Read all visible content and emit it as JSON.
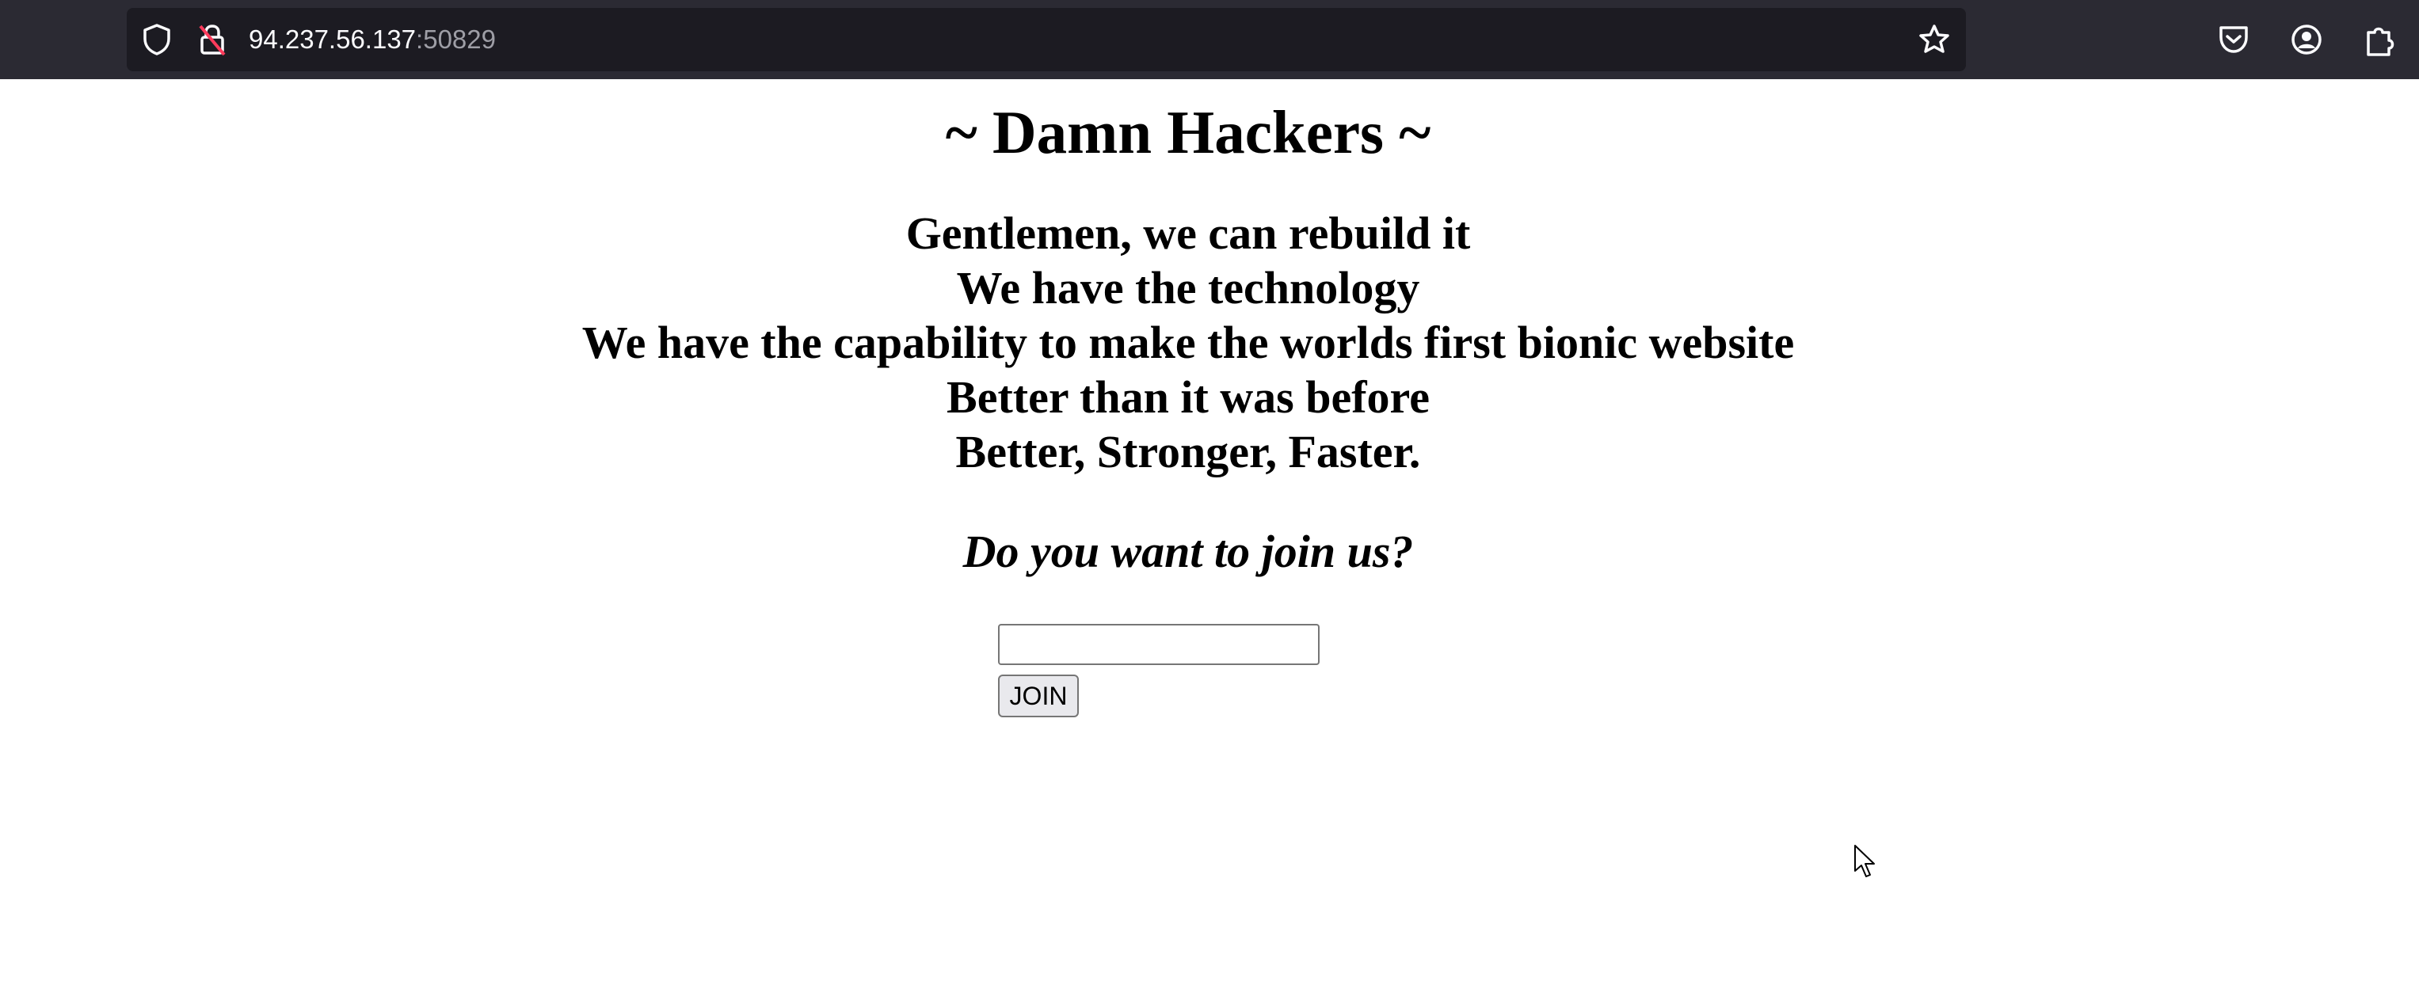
{
  "browser": {
    "url_host": "94.237.56.137",
    "url_port": ":50829",
    "icons": [
      "shield-icon",
      "insecure-lock-icon",
      "bookmark-star-icon",
      "pocket-icon",
      "account-icon",
      "extensions-icon"
    ]
  },
  "page": {
    "title": "~ Damn Hackers ~",
    "lines": [
      "Gentlemen, we can rebuild it",
      "We have the technology",
      "We have the capability to make the worlds first bionic website",
      "Better than it was before",
      "Better, Stronger, Faster."
    ],
    "question": "Do you want to join us?",
    "input_value": "",
    "join_label": "JOIN"
  },
  "colors": {
    "chrome_bg": "#2b2a33",
    "urlbar_bg": "#1c1b22",
    "page_bg": "#ffffff",
    "text": "#000000"
  }
}
